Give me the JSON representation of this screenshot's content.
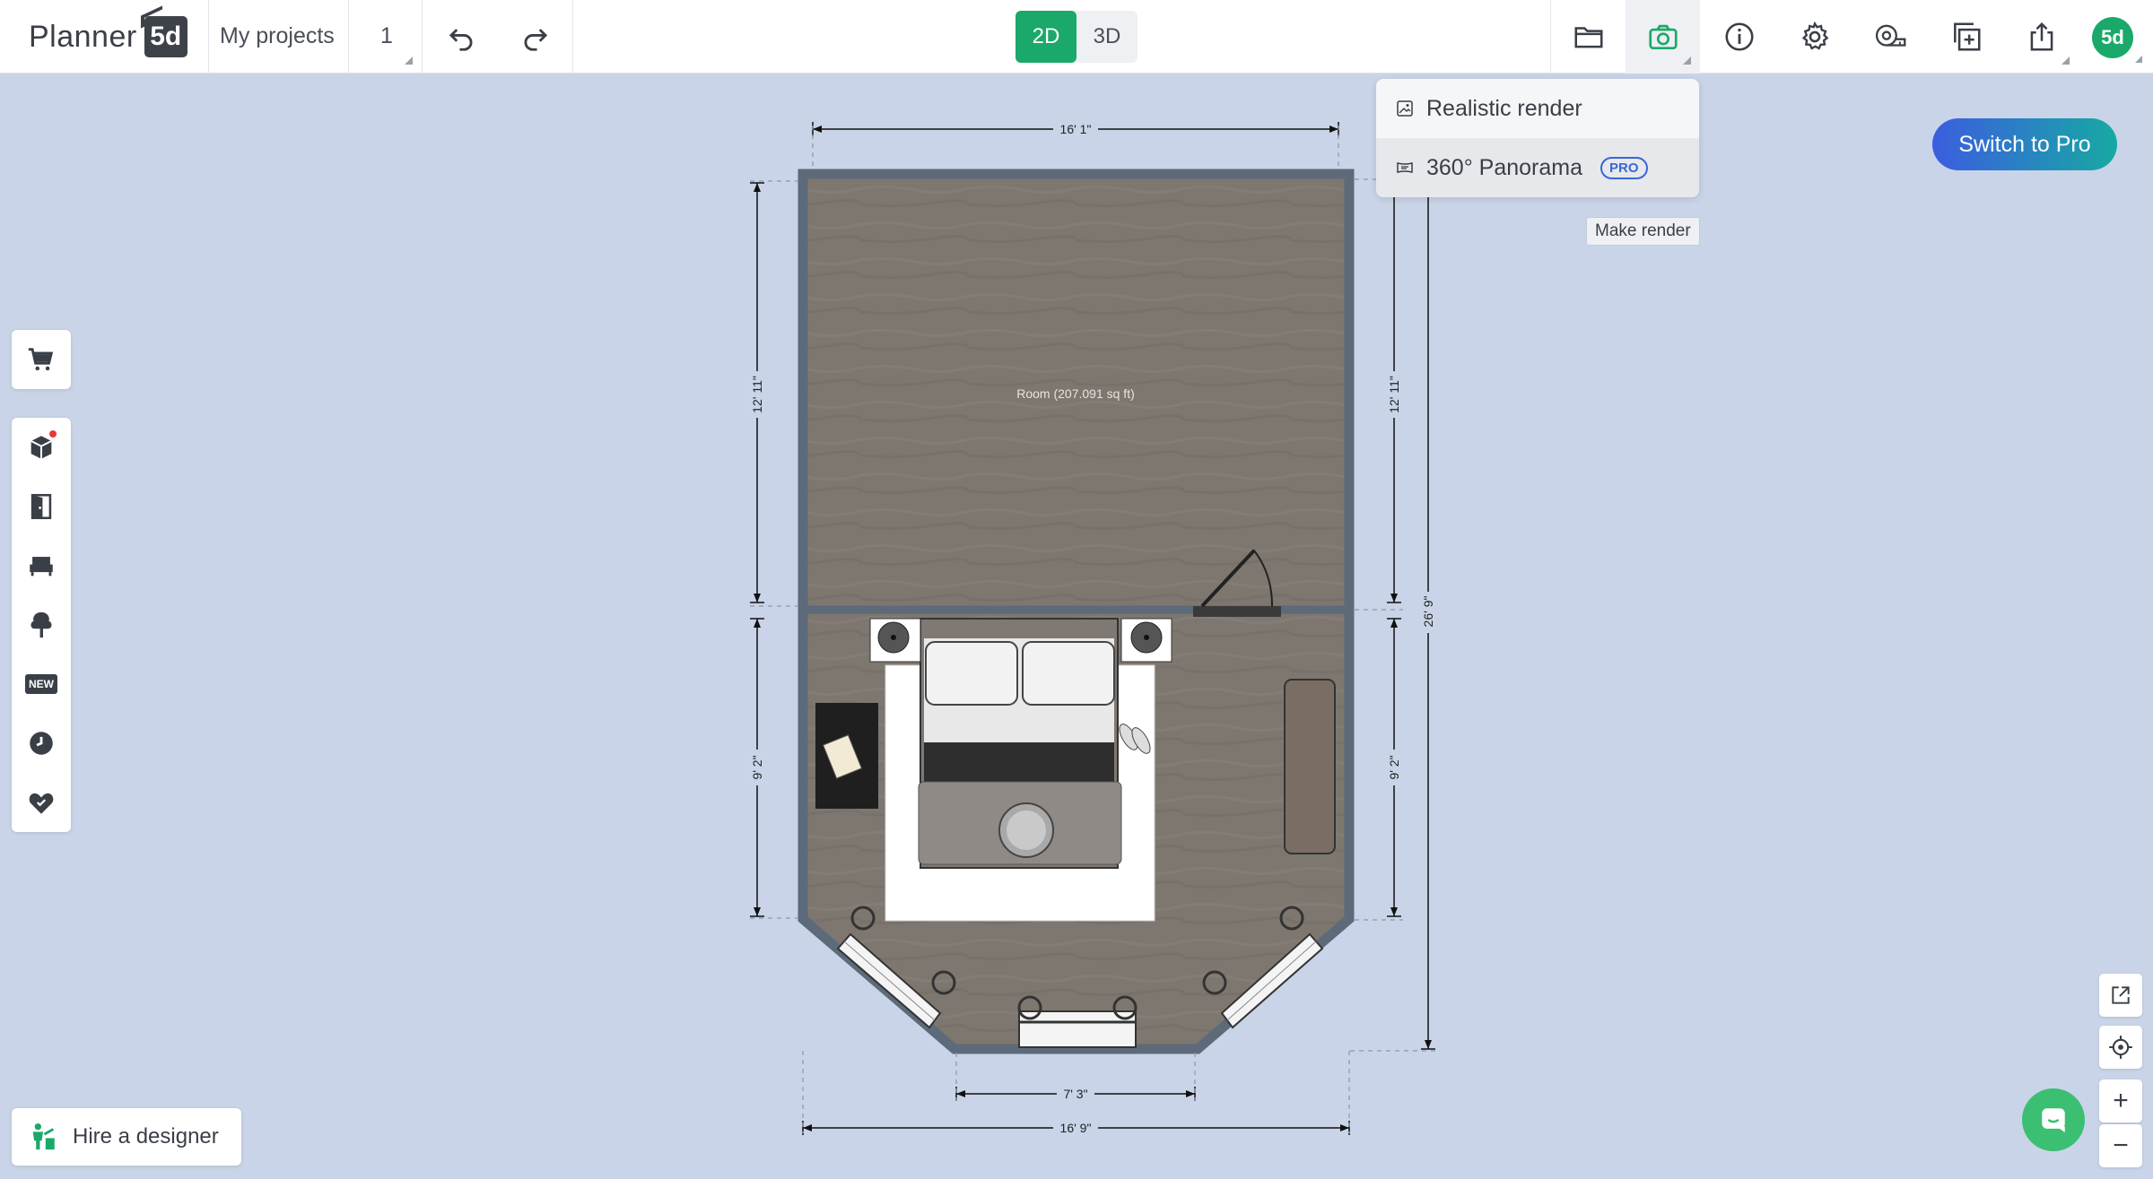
{
  "header": {
    "logo_text": "Planner",
    "logo_badge": "5d",
    "my_projects": "My projects",
    "floor_number": "1",
    "mode_2d": "2D",
    "mode_3d": "3D",
    "avatar_text": "5d"
  },
  "render_menu": {
    "items": [
      {
        "label": "Realistic render"
      },
      {
        "label": "360° Panorama",
        "badge": "PRO"
      }
    ],
    "tooltip": "Make render"
  },
  "pro_button": "Switch to Pro",
  "hire_designer": "Hire a designer",
  "left_toolbar": {
    "new_badge": "NEW"
  },
  "plan": {
    "room_label": "Room (207.091 sq ft)",
    "dims": {
      "top": "16' 1\"",
      "left_upper": "12' 11\"",
      "left_lower": "9' 2\"",
      "right_upper": "12' 11\"",
      "right_lower": "9' 2\"",
      "right_total": "26' 9\"",
      "bottom_inner": "7' 3\"",
      "bottom_outer": "16' 9\""
    }
  },
  "right_tools": {
    "zoom_in": "+",
    "zoom_out": "−"
  },
  "colors": {
    "accent_green": "#1aa96a",
    "canvas": "#c9d4e8",
    "floor": "#7e766f",
    "wall": "#5c6a7a"
  }
}
